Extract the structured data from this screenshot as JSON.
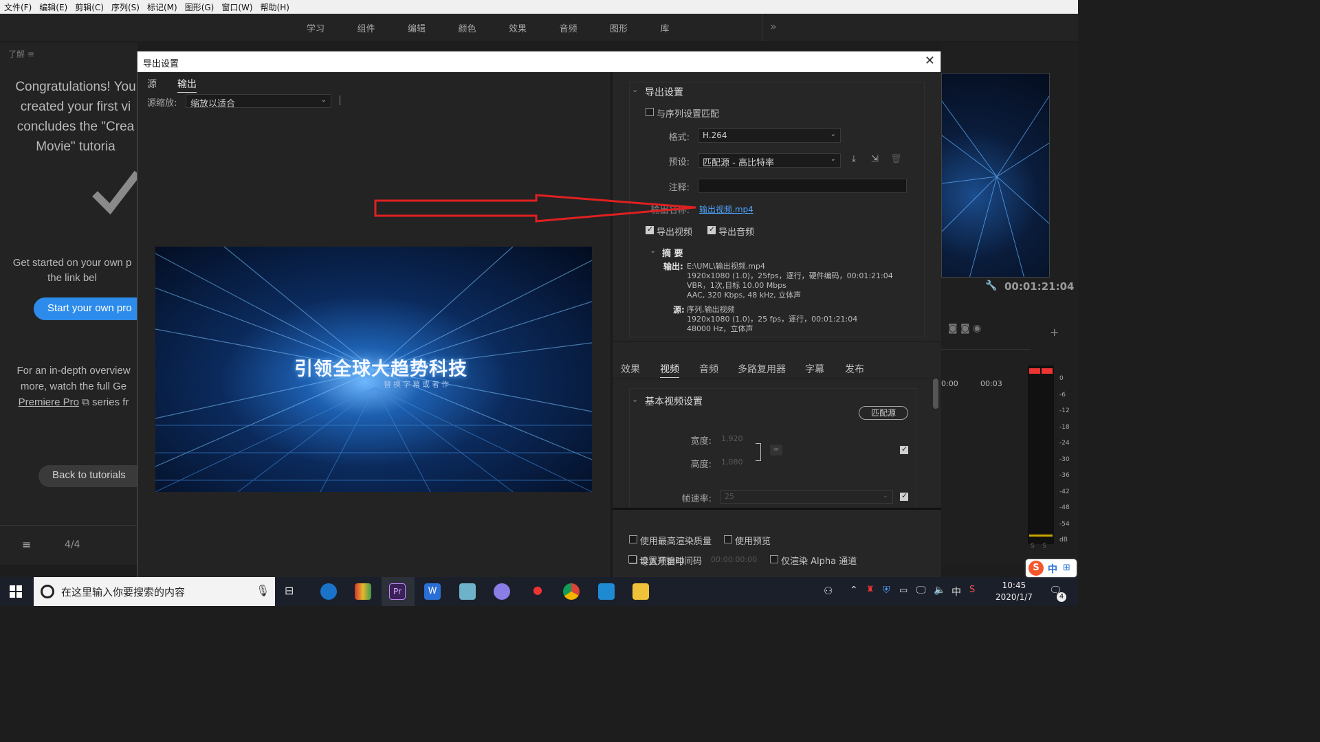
{
  "menu": [
    "文件(F)",
    "编辑(E)",
    "剪辑(C)",
    "序列(S)",
    "标记(M)",
    "图形(G)",
    "窗口(W)",
    "帮助(H)"
  ],
  "workspaces": [
    "学习",
    "组件",
    "编辑",
    "颜色",
    "效果",
    "音频",
    "图形",
    "库"
  ],
  "learn_panel": {
    "title": "了解",
    "congrats_lines": [
      "Congratulations! You",
      "created your first vi",
      "concludes the \"Crea",
      "Movie\" tutoria"
    ],
    "started_lines": [
      "Get started on your own p",
      "the link bel"
    ],
    "start_button": "Start your own pro",
    "overview_lines": [
      "For an in-depth overview",
      "more, watch the full Ge",
      "Premiere Pro",
      "series fr"
    ],
    "back_button": "Back to tutorials",
    "page": "4/4"
  },
  "dialog": {
    "title": "导出设置",
    "left_tabs": [
      "源",
      "输出"
    ],
    "active_left_tab": "输出",
    "source_scale_label": "源缩放:",
    "source_scale_value": "缩放以适合",
    "preview_title": "引领全球大趋势科技",
    "preview_subtitle": "替换字幕或者作",
    "export_settings": {
      "header": "导出设置",
      "match_sequence": "与序列设置匹配",
      "format_label": "格式:",
      "format_value": "H.264",
      "preset_label": "预设:",
      "preset_value": "匹配源 - 高比特率",
      "comment_label": "注释:",
      "output_name_label": "输出名称:",
      "output_name_value": "输出视频.mp4",
      "export_video": "导出视频",
      "export_audio": "导出音频",
      "summary_header": "摘 要",
      "output_label": "输出:",
      "output_lines": [
        "E:\\UML\\输出视频.mp4",
        "1920x1080 (1.0)，25fps，逐行，硬件编码，00:01:21:04",
        "VBR，1次,目标 10.00 Mbps",
        "AAC, 320 Kbps, 48  kHz, 立体声"
      ],
      "source_label": "源:",
      "source_lines": [
        "序列,输出视频",
        "1920x1080 (1.0)，25 fps，逐行，00:01:21:04",
        "48000 Hz，立体声"
      ]
    },
    "bottom_tabs": [
      "效果",
      "视频",
      "音频",
      "多路复用器",
      "字幕",
      "发布"
    ],
    "active_bottom_tab": "视频",
    "basic_video": {
      "header": "基本视频设置",
      "match_source": "匹配源",
      "width_label": "宽度:",
      "width_value": "1,920",
      "height_label": "高度:",
      "height_value": "1,080",
      "framerate_label": "帧速率:",
      "framerate_value": "25"
    },
    "footer_options": [
      "使用最高渲染质量",
      "使用预览",
      "导入项目中",
      "设置开始时间码",
      "仅渲染 Alpha 通道"
    ],
    "start_timecode": "00:00:00:00"
  },
  "right_panel": {
    "timecode": "00:01:21:04",
    "ruler": [
      "0:00",
      "00:03"
    ],
    "meter_scale": [
      "0",
      "-6",
      "-12",
      "-18",
      "-24",
      "-30",
      "-36",
      "-42",
      "-48",
      "-54",
      "dB"
    ],
    "meter_buttons": [
      "S",
      "S"
    ]
  },
  "taskbar": {
    "search_placeholder": "在这里输入你要搜索的内容",
    "time": "10:45",
    "date": "2020/1/7",
    "ime": "中",
    "notification_count": "4"
  },
  "colors": {
    "accent_blue": "#2d8ceb",
    "annotation_red": "#e02020",
    "link_blue": "#4da3ff"
  }
}
